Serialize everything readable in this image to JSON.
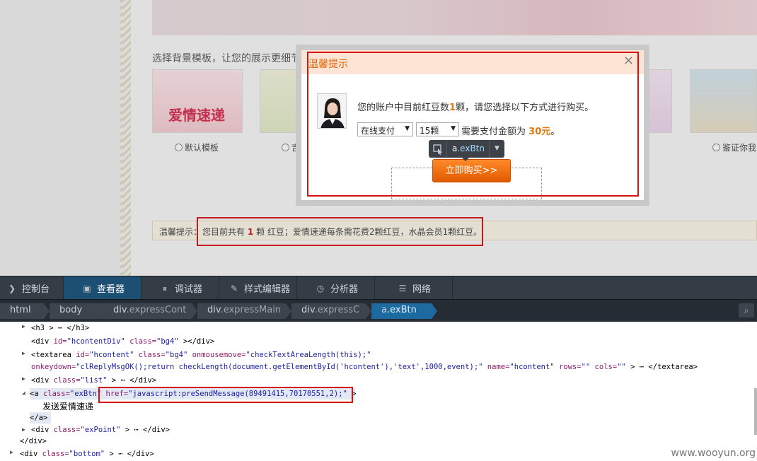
{
  "page": {
    "template_title": "选择背景模板，让您的展示更细节",
    "templates": [
      {
        "label": "默认模板"
      },
      {
        "label": "吉"
      },
      {
        "label": "鉴证你我"
      }
    ],
    "thumb_text_1": "爱情速递",
    "hint_label": "温馨提示：",
    "hint_prefix": "您目前共有",
    "hint_count": "1",
    "hint_suffix": "颗 红豆；爱情速递每条需花费2颗红豆，水晶会员1颗红豆。"
  },
  "modal": {
    "title": "温馨提示",
    "close": "×",
    "account_prefix": "您的账户中目前红豆数",
    "account_count": "1",
    "account_suffix": "颗，请您选择以下方式进行购买。",
    "pay_method": "在线支付",
    "quantity": "15颗",
    "pay_prefix": "需要支付金额为",
    "pay_amount": "30元",
    "pay_suffix": "。",
    "buy_button": "立即购买>>",
    "tooltip_tag": "a",
    "tooltip_class": ".exBtn"
  },
  "devtools": {
    "tabs": [
      {
        "label": "控制台",
        "icon": "console-icon"
      },
      {
        "label": "查看器",
        "icon": "inspector-icon"
      },
      {
        "label": "调试器",
        "icon": "debugger-icon"
      },
      {
        "label": "样式编辑器",
        "icon": "style-editor-icon"
      },
      {
        "label": "分析器",
        "icon": "profiler-icon"
      },
      {
        "label": "网络",
        "icon": "network-icon"
      }
    ],
    "breadcrumbs": [
      {
        "tag": "html",
        "cls": ""
      },
      {
        "tag": "body",
        "cls": ""
      },
      {
        "tag": "div",
        "cls": ".expressCont"
      },
      {
        "tag": "div",
        "cls": ".expressMain"
      },
      {
        "tag": "div",
        "cls": ".expressC"
      },
      {
        "tag": "a",
        "cls": ".exBtn"
      }
    ],
    "markup": {
      "l1": "<h3  > ⋯ </h3>",
      "l2_open": "<div ",
      "l2_attr1": "id=",
      "l2_val1": "\"hcontentDiv\"",
      "l2_attr2": " class=",
      "l2_val2": "\"bg4\"",
      "l2_close": "  ></div>",
      "l3_open": "<textarea ",
      "l3_attr1": "id=",
      "l3_val1": "\"hcontent\"",
      "l3_attr2": " class=",
      "l3_val2": "\"bg4\"",
      "l3_attr3": " onmousemove=",
      "l3_val3": "\"checkTextAreaLength(this);\"",
      "l4_attr1": "onkeydown=",
      "l4_val1": "\"clReplyMsgOK();return checkLength(document.getElementById('hcontent'),'text',1000,event);\"",
      "l4_attr2": " name=",
      "l4_val2": "\"hcontent\"",
      "l4_attr3": " rows=",
      "l4_val3": "\"\"",
      "l4_attr4": " cols=",
      "l4_val4": "\"\"",
      "l4_close": "  > ⋯ </textarea>",
      "l5_open": "<div ",
      "l5_attr": "class=",
      "l5_val": "\"list\"",
      "l5_close": "  > ⋯ </div>",
      "l6_open": "<a ",
      "l6_attr1": "class=",
      "l6_val1": "\"exBtn\"",
      "l6_attr2": " href=",
      "l6_val2": "\"javascript:preSendMessage(89491415,70170551,2);\"",
      "l6_close": "  >",
      "l7": "发送爱情速递",
      "l8": "</a>",
      "l9_open": "<div ",
      "l9_attr": "class=",
      "l9_val": "\"exPoint\"",
      "l9_close": "  > ⋯ </div>",
      "l10": "</div>",
      "l11_open": "<div ",
      "l11_attr": "class=",
      "l11_val": "\"bottom\"",
      "l11_close": "  > ⋯ </div>"
    },
    "watermark": "www.wooyun.org"
  },
  "colors": {
    "accent": "#e07a10",
    "highlight": "#d71010",
    "devtools_bg": "#343c45",
    "active_tab": "#1d4f73"
  }
}
